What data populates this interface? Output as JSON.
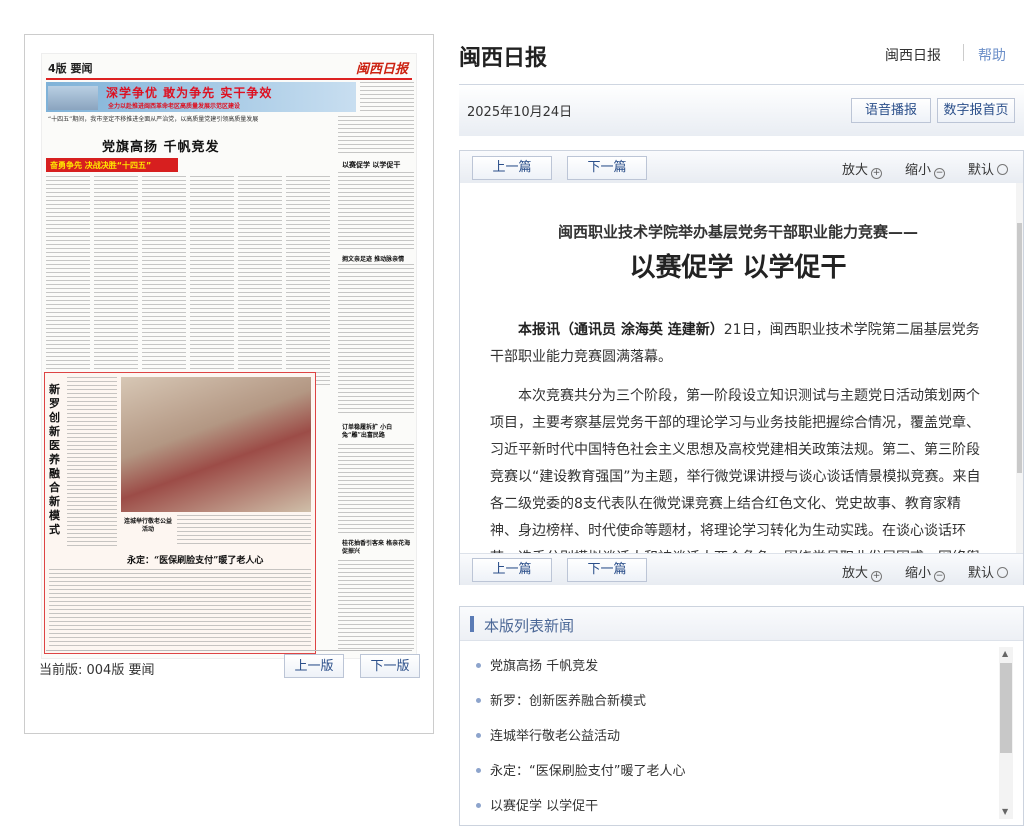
{
  "newspaper_page": {
    "edition_label": "4版 要闻",
    "masthead": "闽西日报",
    "banner_title": "深学争优  敢为争先  实干争效",
    "banner_subtitle": "全力以赴推进闽西革命老区高质量发展示范区建设",
    "lead": "“十四五”期间，我市坚定不移推进全面从严治党，以高质量党建引领高质量发展",
    "headline": "党旗高扬  千帆竞发",
    "red_bar": "奋勇争先 决战决胜“十四五”",
    "side_title_1": "以赛促学 以学促干",
    "side_title_2": "拥文亲足迹 推动脉亲情",
    "side_title_3": "订单稳履拆扩 小白兔“雕”出富民路",
    "side_title_4": "桂花抽香引客来 格亲花海促振兴",
    "box_vertical_title": "新罗创新医养融合新模式",
    "photo_caption": "连城举行敬老公益活动",
    "box_headline": "永定：“医保刷脸支付”暖了老人心"
  },
  "page_nav": {
    "current_page": "当前版: 004版 要闻",
    "prev_label": "上一版",
    "next_label": "下一版"
  },
  "header": {
    "site_title": "闽西日报",
    "link_home": "闽西日报",
    "link_help": "帮助"
  },
  "date_bar": {
    "date": "2025年10月24日",
    "audio_button": "语音播报",
    "digital_home_button": "数字报首页"
  },
  "article_nav": {
    "prev_article": "上一篇",
    "next_article": "下一篇",
    "zoom_in": "放大",
    "zoom_out": "缩小",
    "default": "默认"
  },
  "article": {
    "pretitle": "闽西职业技术学院举办基层党务干部职业能力竞赛——",
    "title": "以赛促学 以学促干",
    "byline": "本报讯（通讯员 涂海英 连建新）",
    "p1_rest": "21日，闽西职业技术学院第二届基层党务干部职业能力竞赛圆满落幕。",
    "p2": "本次竞赛共分为三个阶段，第一阶段设立知识测试与主题党日活动策划两个项目，主要考察基层党务干部的理论学习与业务技能把握综合情况，覆盖党章、习近平新时代中国特色社会主义思想及高校党建相关政策法规。第二、第三阶段竞赛以“建设教育强国”为主题，举行微党课讲授与谈心谈话情景模拟竞赛。来自各二级党委的8支代表队在微党课竞赛上结合红色文化、党史故事、教育家精神、身边榜样、时代使命等题材，将理论学习转化为生动实践。在谈心谈话环节，选手分别模拟谈话人和被谈话人两个角色，围绕党员职业发展困惑、网络舆"
  },
  "news_list": {
    "heading": "本版列表新闻",
    "items": [
      "党旗高扬 千帆竞发",
      "新罗：创新医养融合新模式",
      "连城举行敬老公益活动",
      "永定：“医保刷脸支付”暖了老人心",
      "以赛促学 以学促干"
    ]
  },
  "colors": {
    "accent_blue": "#2b4f8a",
    "heading_blue": "#4b6796",
    "newspaper_red": "#d71f1f"
  }
}
